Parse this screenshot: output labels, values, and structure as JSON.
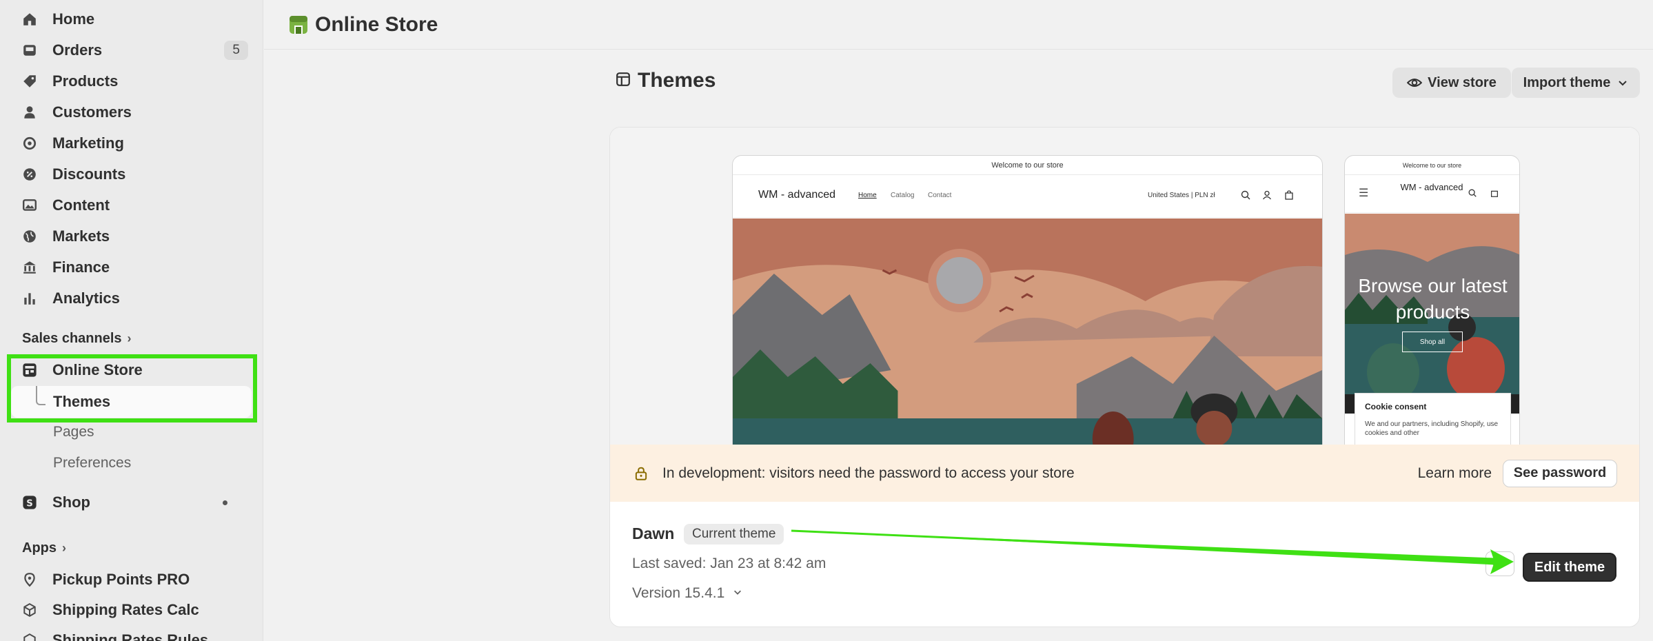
{
  "sidebar": {
    "items": [
      {
        "label": "Home",
        "icon": "home-icon"
      },
      {
        "label": "Orders",
        "icon": "inbox-icon",
        "badge": "5"
      },
      {
        "label": "Products",
        "icon": "tag-icon"
      },
      {
        "label": "Customers",
        "icon": "person-icon"
      },
      {
        "label": "Marketing",
        "icon": "target-icon"
      },
      {
        "label": "Discounts",
        "icon": "discount-icon"
      },
      {
        "label": "Content",
        "icon": "image-icon"
      },
      {
        "label": "Markets",
        "icon": "globe-icon"
      },
      {
        "label": "Finance",
        "icon": "bank-icon"
      },
      {
        "label": "Analytics",
        "icon": "bar-chart-icon"
      }
    ],
    "sales_channels_label": "Sales channels",
    "online_store_label": "Online Store",
    "themes_label": "Themes",
    "pages_label": "Pages",
    "preferences_label": "Preferences",
    "shop_label": "Shop",
    "apps_label": "Apps",
    "apps": [
      {
        "label": "Pickup Points PRO"
      },
      {
        "label": "Shipping Rates Calc"
      },
      {
        "label": "Shipping Rates Rules"
      }
    ]
  },
  "topbar": {
    "title": "Online Store"
  },
  "page": {
    "title": "Themes",
    "view_store": "View store",
    "import_theme": "Import theme"
  },
  "preview": {
    "announcement": "Welcome to our store",
    "store_name": "WM - advanced",
    "nav": [
      "Home",
      "Catalog",
      "Contact"
    ],
    "locale": "United States | PLN zł",
    "mobile_store_name": "WM - advanced",
    "mobile_heading": "Browse our latest products",
    "mobile_shop_all": "Shop all",
    "cookie_title": "Cookie consent",
    "cookie_text": "We and our partners, including Shopify, use cookies and other"
  },
  "dev_notice": {
    "text": "In development: visitors need the password to access your store",
    "learn_more": "Learn more",
    "see_password": "See password"
  },
  "theme": {
    "name": "Dawn",
    "badge": "Current theme",
    "last_saved": "Last saved: Jan 23 at 8:42 am",
    "version": "Version 15.4.1",
    "more": "•••",
    "edit": "Edit theme"
  },
  "colors": {
    "highlight": "#3fe014",
    "sidebar_bg": "#ebebeb",
    "notice_bg": "#fdf0e1",
    "primary_button": "#303030"
  }
}
